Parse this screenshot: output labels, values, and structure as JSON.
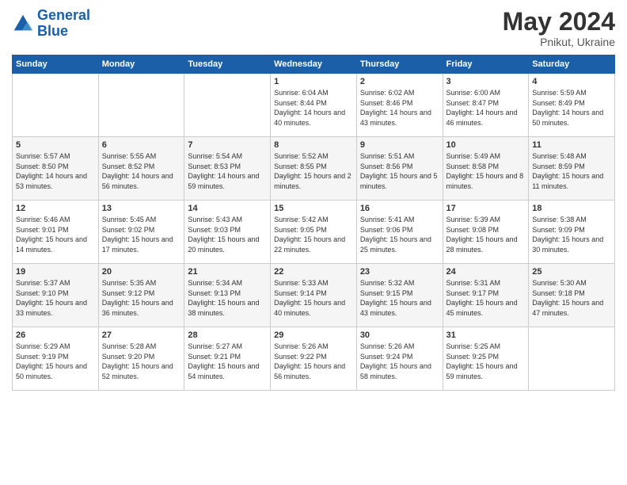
{
  "logo": {
    "line1": "General",
    "line2": "Blue"
  },
  "title": "May 2024",
  "location": "Pnikut, Ukraine",
  "days_header": [
    "Sunday",
    "Monday",
    "Tuesday",
    "Wednesday",
    "Thursday",
    "Friday",
    "Saturday"
  ],
  "weeks": [
    [
      {
        "day": "",
        "sunrise": "",
        "sunset": "",
        "daylight": ""
      },
      {
        "day": "",
        "sunrise": "",
        "sunset": "",
        "daylight": ""
      },
      {
        "day": "",
        "sunrise": "",
        "sunset": "",
        "daylight": ""
      },
      {
        "day": "1",
        "sunrise": "Sunrise: 6:04 AM",
        "sunset": "Sunset: 8:44 PM",
        "daylight": "Daylight: 14 hours and 40 minutes."
      },
      {
        "day": "2",
        "sunrise": "Sunrise: 6:02 AM",
        "sunset": "Sunset: 8:46 PM",
        "daylight": "Daylight: 14 hours and 43 minutes."
      },
      {
        "day": "3",
        "sunrise": "Sunrise: 6:00 AM",
        "sunset": "Sunset: 8:47 PM",
        "daylight": "Daylight: 14 hours and 46 minutes."
      },
      {
        "day": "4",
        "sunrise": "Sunrise: 5:59 AM",
        "sunset": "Sunset: 8:49 PM",
        "daylight": "Daylight: 14 hours and 50 minutes."
      }
    ],
    [
      {
        "day": "5",
        "sunrise": "Sunrise: 5:57 AM",
        "sunset": "Sunset: 8:50 PM",
        "daylight": "Daylight: 14 hours and 53 minutes."
      },
      {
        "day": "6",
        "sunrise": "Sunrise: 5:55 AM",
        "sunset": "Sunset: 8:52 PM",
        "daylight": "Daylight: 14 hours and 56 minutes."
      },
      {
        "day": "7",
        "sunrise": "Sunrise: 5:54 AM",
        "sunset": "Sunset: 8:53 PM",
        "daylight": "Daylight: 14 hours and 59 minutes."
      },
      {
        "day": "8",
        "sunrise": "Sunrise: 5:52 AM",
        "sunset": "Sunset: 8:55 PM",
        "daylight": "Daylight: 15 hours and 2 minutes."
      },
      {
        "day": "9",
        "sunrise": "Sunrise: 5:51 AM",
        "sunset": "Sunset: 8:56 PM",
        "daylight": "Daylight: 15 hours and 5 minutes."
      },
      {
        "day": "10",
        "sunrise": "Sunrise: 5:49 AM",
        "sunset": "Sunset: 8:58 PM",
        "daylight": "Daylight: 15 hours and 8 minutes."
      },
      {
        "day": "11",
        "sunrise": "Sunrise: 5:48 AM",
        "sunset": "Sunset: 8:59 PM",
        "daylight": "Daylight: 15 hours and 11 minutes."
      }
    ],
    [
      {
        "day": "12",
        "sunrise": "Sunrise: 5:46 AM",
        "sunset": "Sunset: 9:01 PM",
        "daylight": "Daylight: 15 hours and 14 minutes."
      },
      {
        "day": "13",
        "sunrise": "Sunrise: 5:45 AM",
        "sunset": "Sunset: 9:02 PM",
        "daylight": "Daylight: 15 hours and 17 minutes."
      },
      {
        "day": "14",
        "sunrise": "Sunrise: 5:43 AM",
        "sunset": "Sunset: 9:03 PM",
        "daylight": "Daylight: 15 hours and 20 minutes."
      },
      {
        "day": "15",
        "sunrise": "Sunrise: 5:42 AM",
        "sunset": "Sunset: 9:05 PM",
        "daylight": "Daylight: 15 hours and 22 minutes."
      },
      {
        "day": "16",
        "sunrise": "Sunrise: 5:41 AM",
        "sunset": "Sunset: 9:06 PM",
        "daylight": "Daylight: 15 hours and 25 minutes."
      },
      {
        "day": "17",
        "sunrise": "Sunrise: 5:39 AM",
        "sunset": "Sunset: 9:08 PM",
        "daylight": "Daylight: 15 hours and 28 minutes."
      },
      {
        "day": "18",
        "sunrise": "Sunrise: 5:38 AM",
        "sunset": "Sunset: 9:09 PM",
        "daylight": "Daylight: 15 hours and 30 minutes."
      }
    ],
    [
      {
        "day": "19",
        "sunrise": "Sunrise: 5:37 AM",
        "sunset": "Sunset: 9:10 PM",
        "daylight": "Daylight: 15 hours and 33 minutes."
      },
      {
        "day": "20",
        "sunrise": "Sunrise: 5:35 AM",
        "sunset": "Sunset: 9:12 PM",
        "daylight": "Daylight: 15 hours and 36 minutes."
      },
      {
        "day": "21",
        "sunrise": "Sunrise: 5:34 AM",
        "sunset": "Sunset: 9:13 PM",
        "daylight": "Daylight: 15 hours and 38 minutes."
      },
      {
        "day": "22",
        "sunrise": "Sunrise: 5:33 AM",
        "sunset": "Sunset: 9:14 PM",
        "daylight": "Daylight: 15 hours and 40 minutes."
      },
      {
        "day": "23",
        "sunrise": "Sunrise: 5:32 AM",
        "sunset": "Sunset: 9:15 PM",
        "daylight": "Daylight: 15 hours and 43 minutes."
      },
      {
        "day": "24",
        "sunrise": "Sunrise: 5:31 AM",
        "sunset": "Sunset: 9:17 PM",
        "daylight": "Daylight: 15 hours and 45 minutes."
      },
      {
        "day": "25",
        "sunrise": "Sunrise: 5:30 AM",
        "sunset": "Sunset: 9:18 PM",
        "daylight": "Daylight: 15 hours and 47 minutes."
      }
    ],
    [
      {
        "day": "26",
        "sunrise": "Sunrise: 5:29 AM",
        "sunset": "Sunset: 9:19 PM",
        "daylight": "Daylight: 15 hours and 50 minutes."
      },
      {
        "day": "27",
        "sunrise": "Sunrise: 5:28 AM",
        "sunset": "Sunset: 9:20 PM",
        "daylight": "Daylight: 15 hours and 52 minutes."
      },
      {
        "day": "28",
        "sunrise": "Sunrise: 5:27 AM",
        "sunset": "Sunset: 9:21 PM",
        "daylight": "Daylight: 15 hours and 54 minutes."
      },
      {
        "day": "29",
        "sunrise": "Sunrise: 5:26 AM",
        "sunset": "Sunset: 9:22 PM",
        "daylight": "Daylight: 15 hours and 56 minutes."
      },
      {
        "day": "30",
        "sunrise": "Sunrise: 5:26 AM",
        "sunset": "Sunset: 9:24 PM",
        "daylight": "Daylight: 15 hours and 58 minutes."
      },
      {
        "day": "31",
        "sunrise": "Sunrise: 5:25 AM",
        "sunset": "Sunset: 9:25 PM",
        "daylight": "Daylight: 15 hours and 59 minutes."
      },
      {
        "day": "",
        "sunrise": "",
        "sunset": "",
        "daylight": ""
      }
    ]
  ]
}
